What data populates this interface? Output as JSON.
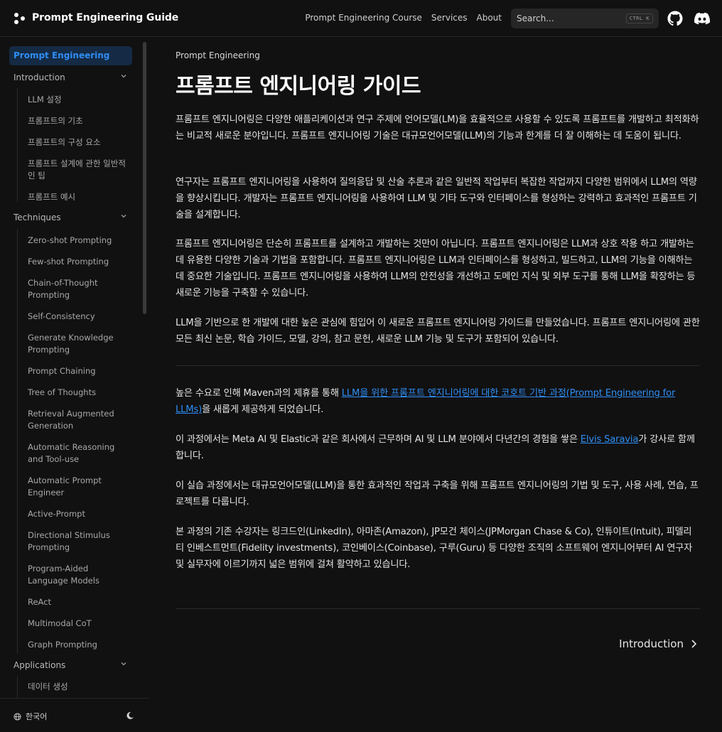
{
  "header": {
    "title": "Prompt Engineering Guide",
    "nav": [
      "Prompt Engineering Course",
      "Services",
      "About"
    ],
    "search_placeholder": "Search...",
    "search_kbd": "CTRL K"
  },
  "sidebar": {
    "active": "Prompt Engineering",
    "sections": [
      {
        "label": "Introduction",
        "items": [
          "LLM 설정",
          "프롬프트의 기초",
          "프롬프트의 구성 요소",
          "프롬프트 설계에 관한 일반적인 팁",
          "프롬프트 예시"
        ]
      },
      {
        "label": "Techniques",
        "items": [
          "Zero-shot Prompting",
          "Few-shot Prompting",
          "Chain-of-Thought Prompting",
          "Self-Consistency",
          "Generate Knowledge Prompting",
          "Prompt Chaining",
          "Tree of Thoughts",
          "Retrieval Augmented Generation",
          "Automatic Reasoning and Tool-use",
          "Automatic Prompt Engineer",
          "Active-Prompt",
          "Directional Stimulus Prompting",
          "Program-Aided Language Models",
          "ReAct",
          "Multimodal CoT",
          "Graph Prompting"
        ]
      },
      {
        "label": "Applications",
        "items": [
          "데이터 생성"
        ]
      }
    ],
    "language": "한국어"
  },
  "main": {
    "breadcrumb": "Prompt Engineering",
    "title": "프롬프트 엔지니어링 가이드",
    "p1": "프롬프트 엔지니어링은 다양한 애플리케이션과 연구 주제에 언어모델(LM)을 효율적으로 사용할 수 있도록 프롬프트를 개발하고 최적화하는 비교적 새로운 분야입니다. 프롬프트 엔지니어링 기술은 대규모언어모델(LLM)의 기능과 한계를 더 잘 이해하는 데 도움이 됩니다.",
    "p2": "연구자는 프롬프트 엔지니어링을 사용하여 질의응답 및 산술 추론과 같은 일반적 작업부터 복잡한 작업까지 다양한 범위에서 LLM의 역량을 향상시킵니다. 개발자는 프롬프트 엔지니어링을 사용하여 LLM 및 기타 도구와 인터페이스를 형성하는 강력하고 효과적인 프롬프트 기술을 설계합니다.",
    "p3": "프롬프트 엔지니어링은 단순히 프롬프트를 설계하고 개발하는 것만이 아닙니다. 프롬프트 엔지니어링은 LLM과 상호 작용 하고 개발하는 데 유용한 다양한 기술과 기법을 포함합니다. 프롬프트 엔지니어링은 LLM과 인터페이스를 형성하고, 빌드하고, LLM의 기능을 이해하는 데 중요한 기술입니다. 프롬프트 엔지니어링을 사용하여 LLM의 안전성을 개선하고 도메인 지식 및 외부 도구를 통해 LLM을 확장하는 등 새로운 기능을 구축할 수 있습니다.",
    "p4": "LLM을 기반으로 한 개발에 대한 높은 관심에 힘입어 이 새로운 프롬프트 엔지니어링 가이드를 만들었습니다. 프롬프트 엔지니어링에 관한 모든 최신 논문, 학습 가이드, 모델, 강의, 참고 문헌, 새로운 LLM 기능 및 도구가 포함되어 있습니다.",
    "p5_pre": "높은 수요로 인해 Maven과의 제휴를 통해 ",
    "p5_link": "LLM을 위한 프롬프트 엔지니어링에 대한 코호트 기반 과정(Prompt Engineering for LLMs)",
    "p5_post": "을 새롭게 제공하게 되었습니다.",
    "p6_pre": "이 과정에서는 Meta AI 및 Elastic과 같은 회사에서 근무하며 AI 및 LLM 분야에서 다년간의 경험을 쌓은 ",
    "p6_link": "Elvis Saravia",
    "p6_post": "가 강사로 함께합니다.",
    "p7": "이 실습 과정에서는 대규모언어모델(LLM)을 통한 효과적인 작업과 구축을 위해 프롬프트 엔지니어링의 기법 및 도구, 사용 사례, 연습, 프로젝트를 다룹니다.",
    "p8": "본 과정의 기존 수강자는 링크드인(LinkedIn), 아마존(Amazon), JP모건 체이스(JPMorgan Chase & Co), 인튜이트(Intuit), 피델리티 인베스트먼트(Fidelity investments), 코인베이스(Coinbase), 구루(Guru) 등 다양한 조직의 소프트웨어 엔지니어부터 AI 연구자 및 실무자에 이르기까지 넓은 범위에 걸쳐 활약하고 있습니다.",
    "next": "Introduction"
  },
  "colors": {
    "accent": "#2f8ef4",
    "background": "#111111",
    "active_bg": "#152a44"
  }
}
